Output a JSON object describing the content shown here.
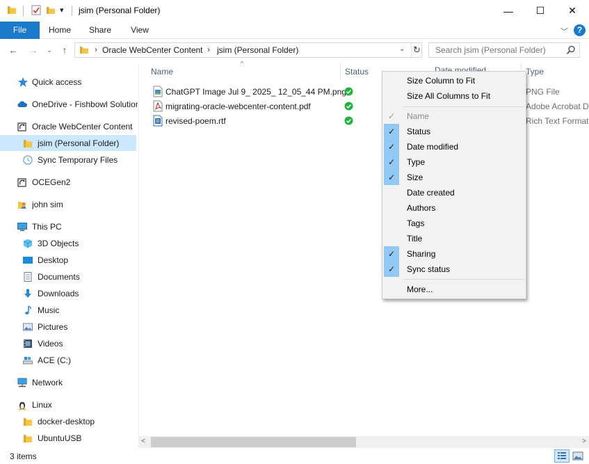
{
  "window": {
    "title": "jsim (Personal Folder)",
    "quick_access_dropdown": "▾",
    "min_glyph": "—",
    "max_glyph": "☐",
    "close_glyph": "✕"
  },
  "ribbon": {
    "tabs": [
      "File",
      "Home",
      "Share",
      "View"
    ],
    "expand_glyph": "﹀",
    "help_glyph": "?"
  },
  "address": {
    "crumb_sep": "›",
    "crumbs": [
      "Oracle WebCenter Content",
      "jsim (Personal Folder)"
    ],
    "dropdown_glyph": "⌄",
    "refresh_glyph": "↻"
  },
  "search": {
    "placeholder": "Search jsim (Personal Folder)"
  },
  "nav": {
    "back": "←",
    "forward": "→",
    "recent": "⌄",
    "up": "↑",
    "items": [
      {
        "label": "Quick access",
        "icon": "star-icon"
      },
      {
        "label": "OneDrive - Fishbowl Solutions",
        "icon": "cloud-icon"
      },
      {
        "label": "Oracle WebCenter Content",
        "icon": "sync-folder-icon"
      },
      {
        "label": "jsim (Personal Folder)",
        "icon": "folder-icon",
        "selected": true
      },
      {
        "label": "Sync Temporary Files",
        "icon": "clock-icon"
      },
      {
        "label": "OCEGen2",
        "icon": "sync-folder-icon"
      },
      {
        "label": "john sim",
        "icon": "user-folder-icon"
      },
      {
        "label": "This PC",
        "icon": "computer-icon"
      },
      {
        "label": "3D Objects",
        "icon": "cube-icon"
      },
      {
        "label": "Desktop",
        "icon": "desktop-icon"
      },
      {
        "label": "Documents",
        "icon": "documents-icon"
      },
      {
        "label": "Downloads",
        "icon": "download-icon"
      },
      {
        "label": "Music",
        "icon": "music-icon"
      },
      {
        "label": "Pictures",
        "icon": "pictures-icon"
      },
      {
        "label": "Videos",
        "icon": "videos-icon"
      },
      {
        "label": "ACE (C:)",
        "icon": "drive-icon"
      },
      {
        "label": "Network",
        "icon": "network-icon"
      },
      {
        "label": "Linux",
        "icon": "linux-icon"
      },
      {
        "label": "docker-desktop",
        "icon": "folder-icon"
      },
      {
        "label": "UbuntuUSB",
        "icon": "folder-icon"
      }
    ]
  },
  "list": {
    "columns": [
      "Name",
      "Status",
      "Date modified",
      "Type"
    ],
    "sort_glyph": "^",
    "files": [
      {
        "name": "ChatGPT Image Jul 9_ 2025_ 12_05_44 PM.png",
        "type": "PNG File",
        "icon": "image-file-icon"
      },
      {
        "name": "migrating-oracle-webcenter-content.pdf",
        "type": "Adobe Acrobat D",
        "icon": "pdf-file-icon"
      },
      {
        "name": "revised-poem.rtf",
        "type": "Rich Text Format",
        "icon": "rtf-file-icon"
      }
    ]
  },
  "context_menu": {
    "fit_items": [
      "Size Column to Fit",
      "Size All Columns to Fit"
    ],
    "check_glyph": "✓",
    "columns": [
      {
        "label": "Name",
        "checked": true,
        "disabled": true
      },
      {
        "label": "Status",
        "checked": true
      },
      {
        "label": "Date modified",
        "checked": true
      },
      {
        "label": "Type",
        "checked": true
      },
      {
        "label": "Size",
        "checked": true
      },
      {
        "label": "Date created",
        "checked": false
      },
      {
        "label": "Authors",
        "checked": false
      },
      {
        "label": "Tags",
        "checked": false
      },
      {
        "label": "Title",
        "checked": false
      },
      {
        "label": "Sharing",
        "checked": true
      },
      {
        "label": "Sync status",
        "checked": true
      }
    ],
    "more": "More..."
  },
  "scroll": {
    "left_glyph": "<",
    "right_glyph": ">"
  },
  "status": {
    "count": "3 items"
  },
  "colors": {
    "accent": "#1979ca",
    "selection": "#cce8ff",
    "menu_check_bg": "#90c8f6",
    "sync_ok": "#1fb53c"
  }
}
